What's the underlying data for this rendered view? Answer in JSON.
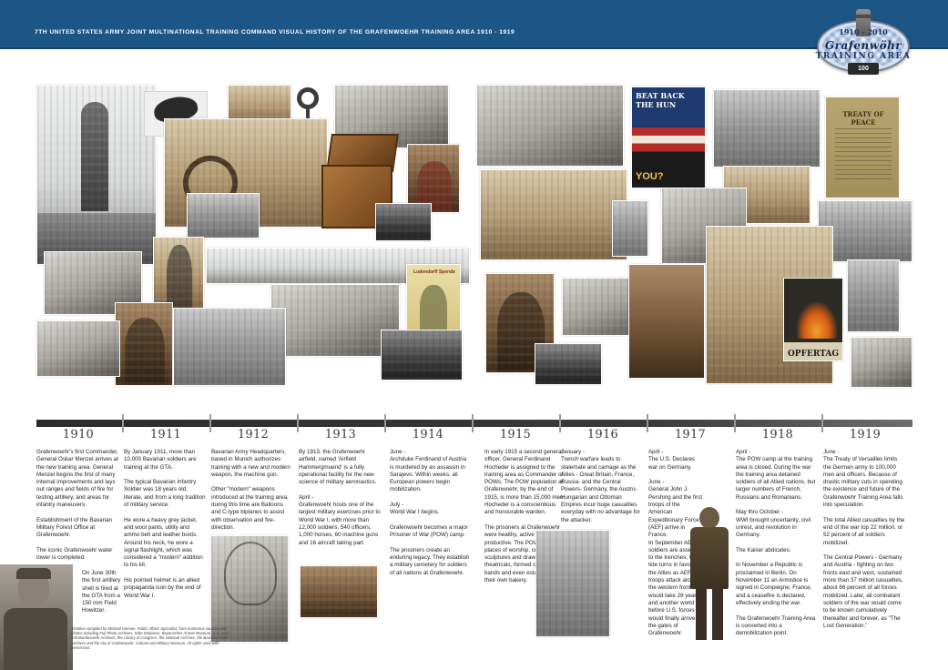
{
  "header": {
    "title": "7TH UNITED STATES ARMY JOINT MULTINATIONAL TRAINING COMMAND VISUAL HISTORY OF THE GRAFENWOEHR TRAINING AREA 1910 - 1919"
  },
  "badge": {
    "years": "1910 - 2010",
    "name": "Grafenwöhr",
    "area": "TRAINING AREA",
    "ribbon": "100 YEARS"
  },
  "posters": {
    "hun": "BEAT BACK THE HUN",
    "hun_you": "YOU?",
    "treaty": "TREATY OF PEACE",
    "opfer": "OPFERTAG",
    "yellow": "Ludendorff Spende"
  },
  "timeline": {
    "years": [
      "1910",
      "1911",
      "1912",
      "1913",
      "1914",
      "1915",
      "1916",
      "1917",
      "1918",
      "1919"
    ]
  },
  "columns": [
    "Grafenwoehr's first Commander, General Oskar Menzel arrives at the new training area. General Menzel begins the first of many internal improvements and lays out ranges and fields of fire for testing artillery, and areas for infantry maneuvers.\n\nEstablishment of the Bavarian Military Forest Office at Grafenwoehr.\n\nThe iconic Grafenwoehr water tower is completed.",
    "By January 1911, more than 10,000 Bavarian soldiers are training at the GTA.\n\nThe typical Bavarian Infantry Soldier was 18 years old, literate, and from a long tradition of military service.\n\nHe wore a heavy grey jacket, and wool pants, utility and ammo belt and leather boots. Around his neck, he wore a signal flashlight, which was considered a \"modern\" addition to his kit.\n\nHis pointed helmet is an allied propaganda icon by the end of World War I.",
    "Bavarian Army Headquarters, based in Munich authorizes training with a new and modern weapon, the machine gun.\n\nOther \"modern\" weapons introduced at the training area, during this time are Balloons and C-type biplanes to assist with observation and fire-direction.",
    "By 1913, the Grafenwoehr airfield, named 'Airfield Hammergmuend' is a fully operational facility for the new science of military aeronautics.\n\nApril -\nGrafenwoehr hosts one of the largest military exercises prior to World War I, with more than 12,000 soldiers, 540 officers, 1,000 horses, 60 machine guns and 16 aircraft taking part.",
    "June -\nArchduke Ferdinand of Austria is murdered by an assassin in Sarajevo. Within weeks, all European powers begin mobilization.\n\nJuly -\nWorld War I begins.\n\nGrafenwoehr becomes a major Prisoner of War (POW) camp.\n\nThe prisoners create an enduring legacy. They establish a military cemetery for soldiers of all nations at Grafenwoehr.",
    "In early 1915 a second general officer, General Ferdinand Hocheder is assigned to the training area as Commander of POWs. The POW population at Grafenwoehr, by the end of 1915, is more than 15,000 men. Hocheder is a conscientious and honourable warden.\n\nThe prisoners at Grafenwoehr were healthy, active and productive. The POWs built places of worship, created sculptures and drawings, staged theatricals, formed concert bands and even established their own bakery.",
    "January -\nTrench warfare leads to stalemate and carnage as the Allies - Great Britain, France, Russia- and the Central Powers- Germany, the Austro-Hungarian and Ottoman Empires incur huge casualties everyday with no advantage for the attacker.",
    "April -\nThe U.S. Declares war on Germany.\n\nJune -\nGeneral John J. Pershing and the first troops of the American Expeditionary Force (AEF) arrive in France.\nIn September AEF soldiers are assigned to the trenches; the tide turns in favor of the Allies as AEF troops attack along the western front. It would take 28 years and another world war before U.S. forces would finally arrive at the gates of Grafenwoehr.",
    "April -\nThe POW camp at the training area is closed. During the war the training area detained soldiers of all Allied nations, but larger numbers of French, Russians and Romanians.\n\nMay thru October -\nWWI brought uncertainty, civil unrest, and revolution in Germany.\n\nThe Kaiser abdicates.\n\nIn November a Republic is proclaimed in Berlin. On November 11 an Armistice is signed in Compiegne, France, and a ceasefire is declared, effectively ending the war.\n\nThe Grafenwoehr Training Area is converted into a demobilization point.",
    "June -\nThe Treaty of Versailles limits the German army to 100,000 men and officers. Because of drastic military cuts in spending the existence and future of the Grafenwoehr Training Area falls into speculation.\n\nThe total Allied casualties by the end of the war top 22 million, or 52 percent of all soldiers mobilized.\n\nThe Central Powers - Germany and Austria - fighting on two fronts east and west, sustained more than 37 million casualties, about 66 percent of all forces mobilized. Later, all combatant soldiers of the war would come to be known cumulatively thereafter and forever, as \"The Lost Generation.\""
  ],
  "artillery_note": "On June 30th the first artillery shell is fired at the GTA from a 150 mm Field Howitzer.",
  "credit": "Timeline compiled by Michael Hansen, Public Affairs Specialist, from numerous sources and photos including Fuji Photo Archives, Gitta Stobaeus, Bayerisches Armee Museum, U.S. Army and Bundeswehr Archives, the Library of Congress, the National Archives, the Bavarian State Archives and the city of Grafenwoehr. Cultural and Military Museum. All rights used with permission.",
  "colors": {
    "header": "#1c5687",
    "timeline_bar": "#2b2b2b",
    "year_text": "#3b3b3b",
    "body_text": "#222222"
  }
}
